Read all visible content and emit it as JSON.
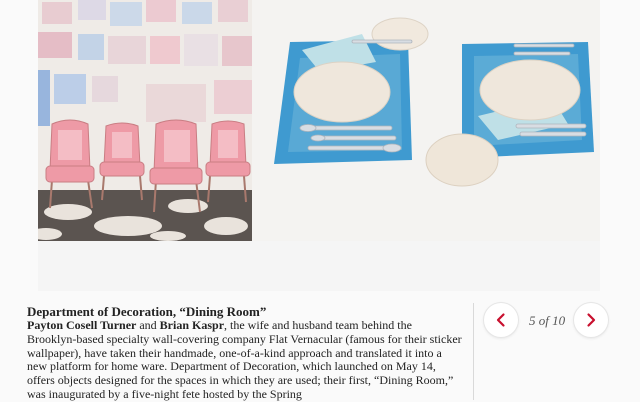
{
  "photos": {
    "left": "chairs-and-painted-wall-hangings-photo",
    "right": "place-settings-on-blue-placemats-photo"
  },
  "caption": {
    "title": "Department of Decoration, “Dining Room”",
    "name_1": "Payton Cosell Turner",
    "joiner": " and ",
    "name_2": "Brian Kaspr",
    "body": ", the wife and husband team behind the Brooklyn-based specialty wall-covering company Flat Vernacular (famous for their sticker wallpaper), have taken their handmade, one-of-a-kind approach and translated it into a new platform for home ware. Department of Decoration, which launched on May 14, offers objects designed for the spaces in which they are used; their first, “Dining Room,” was inaugurated by a five-night fete hosted by the Spring"
  },
  "pager": {
    "current": "5",
    "separator": " of ",
    "total": "10",
    "prev_icon": "chevron-left-icon",
    "next_icon": "chevron-right-icon"
  },
  "colors": {
    "accent": "#c8102e",
    "text": "#222222",
    "muted": "#555555"
  }
}
